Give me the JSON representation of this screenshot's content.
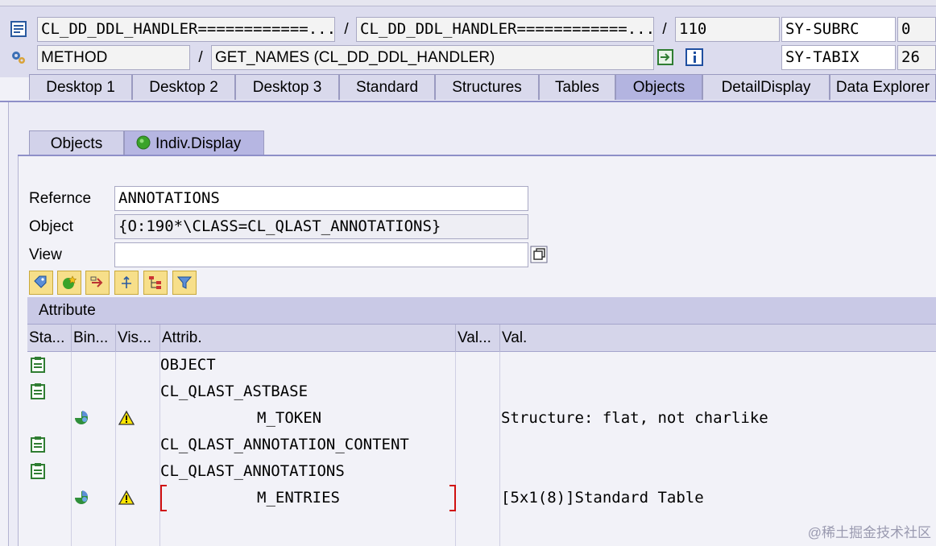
{
  "header": {
    "row1": {
      "program": "CL_DD_DDL_HANDLER============...",
      "include": "CL_DD_DDL_HANDLER============...",
      "line": "110",
      "sysvar": "SY-SUBRC",
      "sysval": "0"
    },
    "row2": {
      "type": "METHOD",
      "event": "GET_NAMES (CL_DD_DDL_HANDLER)",
      "sysvar": "SY-TABIX",
      "sysval": "26"
    },
    "separator": "/"
  },
  "tabs": [
    {
      "label": "Desktop 1"
    },
    {
      "label": "Desktop 2"
    },
    {
      "label": "Desktop 3"
    },
    {
      "label": "Standard"
    },
    {
      "label": "Structures"
    },
    {
      "label": "Tables"
    },
    {
      "label": "Objects",
      "active": true
    },
    {
      "label": "DetailDisplay"
    },
    {
      "label": "Data Explorer"
    }
  ],
  "subtabs": [
    {
      "label": "Objects"
    },
    {
      "label": "Indiv.Display",
      "active": true
    }
  ],
  "form": {
    "reference_label": "Refernce",
    "reference_value": "ANNOTATIONS",
    "object_label": "Object",
    "object_value": "{O:190*\\CLASS=CL_QLAST_ANNOTATIONS}",
    "view_label": "View",
    "view_value": ""
  },
  "toolbar": [
    "tag-icon",
    "add-object-icon",
    "navigate-icon",
    "hierarchy-icon",
    "tree-icon",
    "filter-icon"
  ],
  "attribute_section": "Attribute",
  "columns": [
    "Sta...",
    "Bin...",
    "Vis...",
    "Attrib.",
    "Val...",
    "Val."
  ],
  "rows": [
    {
      "attrib": "OBJECT",
      "val": "",
      "status_icon": true,
      "bind_icon": false,
      "vis_icon": false,
      "indent": false
    },
    {
      "attrib": "CL_QLAST_ASTBASE",
      "val": "",
      "status_icon": true,
      "bind_icon": false,
      "vis_icon": false,
      "indent": false
    },
    {
      "attrib": "M_TOKEN",
      "val": "Structure: flat, not charlike",
      "status_icon": false,
      "bind_icon": true,
      "vis_icon": true,
      "indent": true
    },
    {
      "attrib": "CL_QLAST_ANNOTATION_CONTENT",
      "val": "",
      "status_icon": true,
      "bind_icon": false,
      "vis_icon": false,
      "indent": false
    },
    {
      "attrib": "CL_QLAST_ANNOTATIONS",
      "val": "",
      "status_icon": true,
      "bind_icon": false,
      "vis_icon": false,
      "indent": false
    },
    {
      "attrib": "M_ENTRIES",
      "val": "[5x1(8)]Standard Table",
      "status_icon": false,
      "bind_icon": true,
      "vis_icon": true,
      "indent": true,
      "selected": true
    }
  ],
  "watermark": "@稀土掘金技术社区",
  "colors": {
    "accent": "#8e8fc8",
    "active_tab": "#b3b4e0",
    "toolbar_button": "#f7df8a"
  }
}
